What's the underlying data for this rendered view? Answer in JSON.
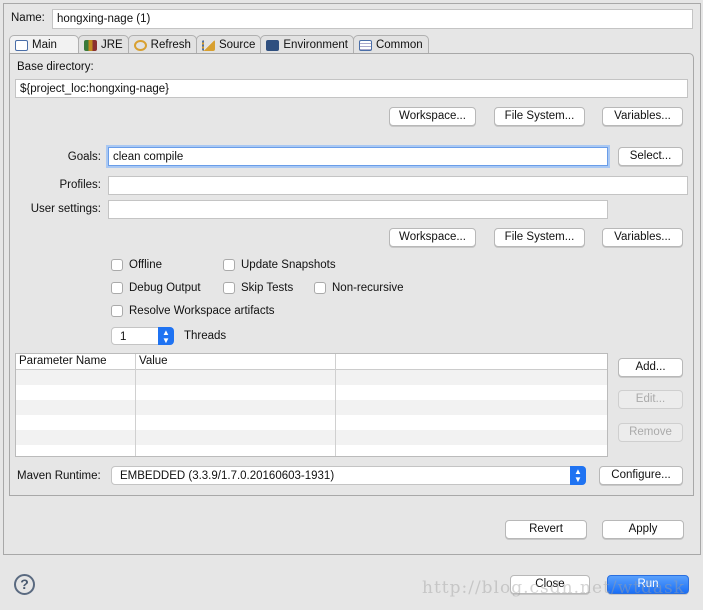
{
  "name": {
    "label": "Name:",
    "value": "hongxing-nage (1)"
  },
  "tabs": [
    {
      "label": "Main",
      "icon": "main-icon"
    },
    {
      "label": "JRE",
      "icon": "books-icon"
    },
    {
      "label": "Refresh",
      "icon": "refresh-icon"
    },
    {
      "label": "Source",
      "icon": "source-icon"
    },
    {
      "label": "Environment",
      "icon": "environment-icon"
    },
    {
      "label": "Common",
      "icon": "common-icon"
    }
  ],
  "main": {
    "base_dir_label": "Base directory:",
    "base_dir_value": "${project_loc:hongxing-nage}",
    "workspace": "Workspace...",
    "file_system": "File System...",
    "variables": "Variables...",
    "goals_label": "Goals:",
    "goals_value": "clean compile",
    "select": "Select...",
    "profiles_label": "Profiles:",
    "profiles_value": "",
    "user_settings_label": "User settings:",
    "user_settings_value": "",
    "checkboxes": {
      "offline": "Offline",
      "update_snapshots": "Update Snapshots",
      "debug_output": "Debug Output",
      "skip_tests": "Skip Tests",
      "non_recursive": "Non-recursive",
      "resolve_workspace": "Resolve Workspace artifacts"
    },
    "threads_value": "1",
    "threads_label": "Threads",
    "table": {
      "columns": [
        "Parameter Name",
        "Value"
      ],
      "rows": []
    },
    "add": "Add...",
    "edit": "Edit...",
    "remove": "Remove",
    "runtime_label": "Maven Runtime:",
    "runtime_value": "EMBEDDED (3.3.9/1.7.0.20160603-1931)",
    "configure": "Configure..."
  },
  "revert": "Revert",
  "apply": "Apply",
  "close": "Close",
  "run": "Run",
  "watermark": "http://blog.csdn.net/wtdask",
  "colors": {
    "accent": "#1f73f2",
    "focus": "#6a9de8"
  }
}
